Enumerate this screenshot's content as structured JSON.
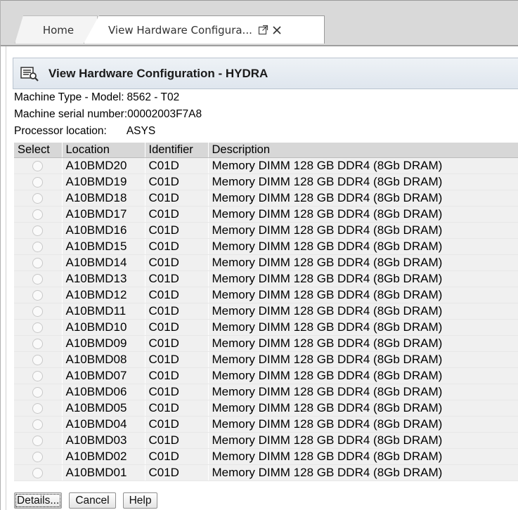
{
  "tabs": [
    {
      "label": "Home"
    },
    {
      "label": "View Hardware Configura..."
    }
  ],
  "icons": {
    "popout": "popout-icon",
    "close": "close-icon",
    "header": "hardware-config-icon"
  },
  "header": {
    "title": "View Hardware Configuration - HYDRA"
  },
  "info": {
    "machine_type_label": "Machine Type - Model:",
    "machine_type_value": "8562 - T02",
    "serial_label": "Machine serial number:",
    "serial_value": "00002003F7A8",
    "processor_label": "Processor location:",
    "processor_value": "ASYS"
  },
  "table": {
    "columns": [
      "Select",
      "Location",
      "Identifier",
      "Description"
    ],
    "rows": [
      {
        "location": "A10BMD20",
        "identifier": "C01D",
        "description": "Memory DIMM 128 GB DDR4 (8Gb DRAM)"
      },
      {
        "location": "A10BMD19",
        "identifier": "C01D",
        "description": "Memory DIMM 128 GB DDR4 (8Gb DRAM)"
      },
      {
        "location": "A10BMD18",
        "identifier": "C01D",
        "description": "Memory DIMM 128 GB DDR4 (8Gb DRAM)"
      },
      {
        "location": "A10BMD17",
        "identifier": "C01D",
        "description": "Memory DIMM 128 GB DDR4 (8Gb DRAM)"
      },
      {
        "location": "A10BMD16",
        "identifier": "C01D",
        "description": "Memory DIMM 128 GB DDR4 (8Gb DRAM)"
      },
      {
        "location": "A10BMD15",
        "identifier": "C01D",
        "description": "Memory DIMM 128 GB DDR4 (8Gb DRAM)"
      },
      {
        "location": "A10BMD14",
        "identifier": "C01D",
        "description": "Memory DIMM 128 GB DDR4 (8Gb DRAM)"
      },
      {
        "location": "A10BMD13",
        "identifier": "C01D",
        "description": "Memory DIMM 128 GB DDR4 (8Gb DRAM)"
      },
      {
        "location": "A10BMD12",
        "identifier": "C01D",
        "description": "Memory DIMM 128 GB DDR4 (8Gb DRAM)"
      },
      {
        "location": "A10BMD11",
        "identifier": "C01D",
        "description": "Memory DIMM 128 GB DDR4 (8Gb DRAM)"
      },
      {
        "location": "A10BMD10",
        "identifier": "C01D",
        "description": "Memory DIMM 128 GB DDR4 (8Gb DRAM)"
      },
      {
        "location": "A10BMD09",
        "identifier": "C01D",
        "description": "Memory DIMM 128 GB DDR4 (8Gb DRAM)"
      },
      {
        "location": "A10BMD08",
        "identifier": "C01D",
        "description": "Memory DIMM 128 GB DDR4 (8Gb DRAM)"
      },
      {
        "location": "A10BMD07",
        "identifier": "C01D",
        "description": "Memory DIMM 128 GB DDR4 (8Gb DRAM)"
      },
      {
        "location": "A10BMD06",
        "identifier": "C01D",
        "description": "Memory DIMM 128 GB DDR4 (8Gb DRAM)"
      },
      {
        "location": "A10BMD05",
        "identifier": "C01D",
        "description": "Memory DIMM 128 GB DDR4 (8Gb DRAM)"
      },
      {
        "location": "A10BMD04",
        "identifier": "C01D",
        "description": "Memory DIMM 128 GB DDR4 (8Gb DRAM)"
      },
      {
        "location": "A10BMD03",
        "identifier": "C01D",
        "description": "Memory DIMM 128 GB DDR4 (8Gb DRAM)"
      },
      {
        "location": "A10BMD02",
        "identifier": "C01D",
        "description": "Memory DIMM 128 GB DDR4 (8Gb DRAM)"
      },
      {
        "location": "A10BMD01",
        "identifier": "C01D",
        "description": "Memory DIMM 128 GB DDR4 (8Gb DRAM)"
      }
    ]
  },
  "buttons": {
    "details": "Details...",
    "cancel": "Cancel",
    "help": "Help"
  }
}
